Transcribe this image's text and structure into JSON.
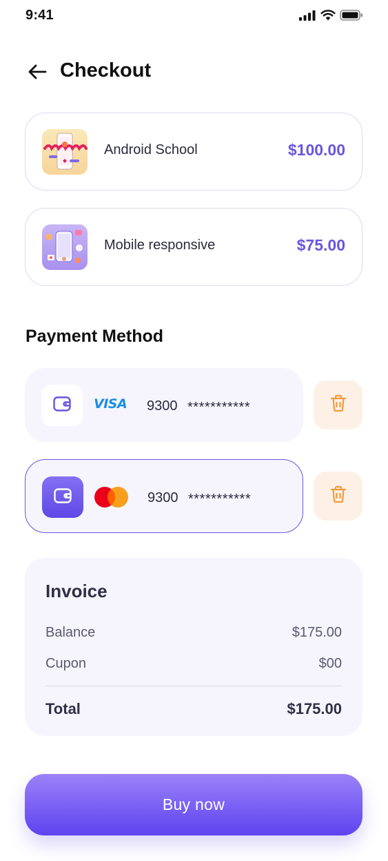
{
  "status_bar": {
    "time": "9:41"
  },
  "header": {
    "title": "Checkout"
  },
  "courses": [
    {
      "title": "Android School",
      "price": "$100.00"
    },
    {
      "title": "Mobile responsive",
      "price": "$75.00"
    }
  ],
  "payment": {
    "title": "Payment Method",
    "cards": [
      {
        "brand": "VISA",
        "last_digits": "9300",
        "mask": "***********",
        "selected": false
      },
      {
        "brand": "mastercard",
        "last_digits": "9300",
        "mask": "***********",
        "selected": true
      }
    ]
  },
  "invoice": {
    "title": "Invoice",
    "balance_label": "Balance",
    "balance_value": "$175.00",
    "coupon_label": "Cupon",
    "coupon_value": "$00",
    "total_label": "Total",
    "total_value": "$175.00"
  },
  "buy_button": {
    "label": "Buy now"
  },
  "colors": {
    "accent": "#6a55e0",
    "card_bg": "#f6f5fd",
    "delete_bg": "#fdf1e6",
    "delete_icon": "#f39a3c",
    "visa": "#1a8fe0"
  },
  "icons": {
    "back": "arrow-left-icon",
    "wallet": "wallet-icon",
    "delete": "trash-icon",
    "signal": "signal-icon",
    "wifi": "wifi-icon",
    "battery": "battery-icon"
  }
}
